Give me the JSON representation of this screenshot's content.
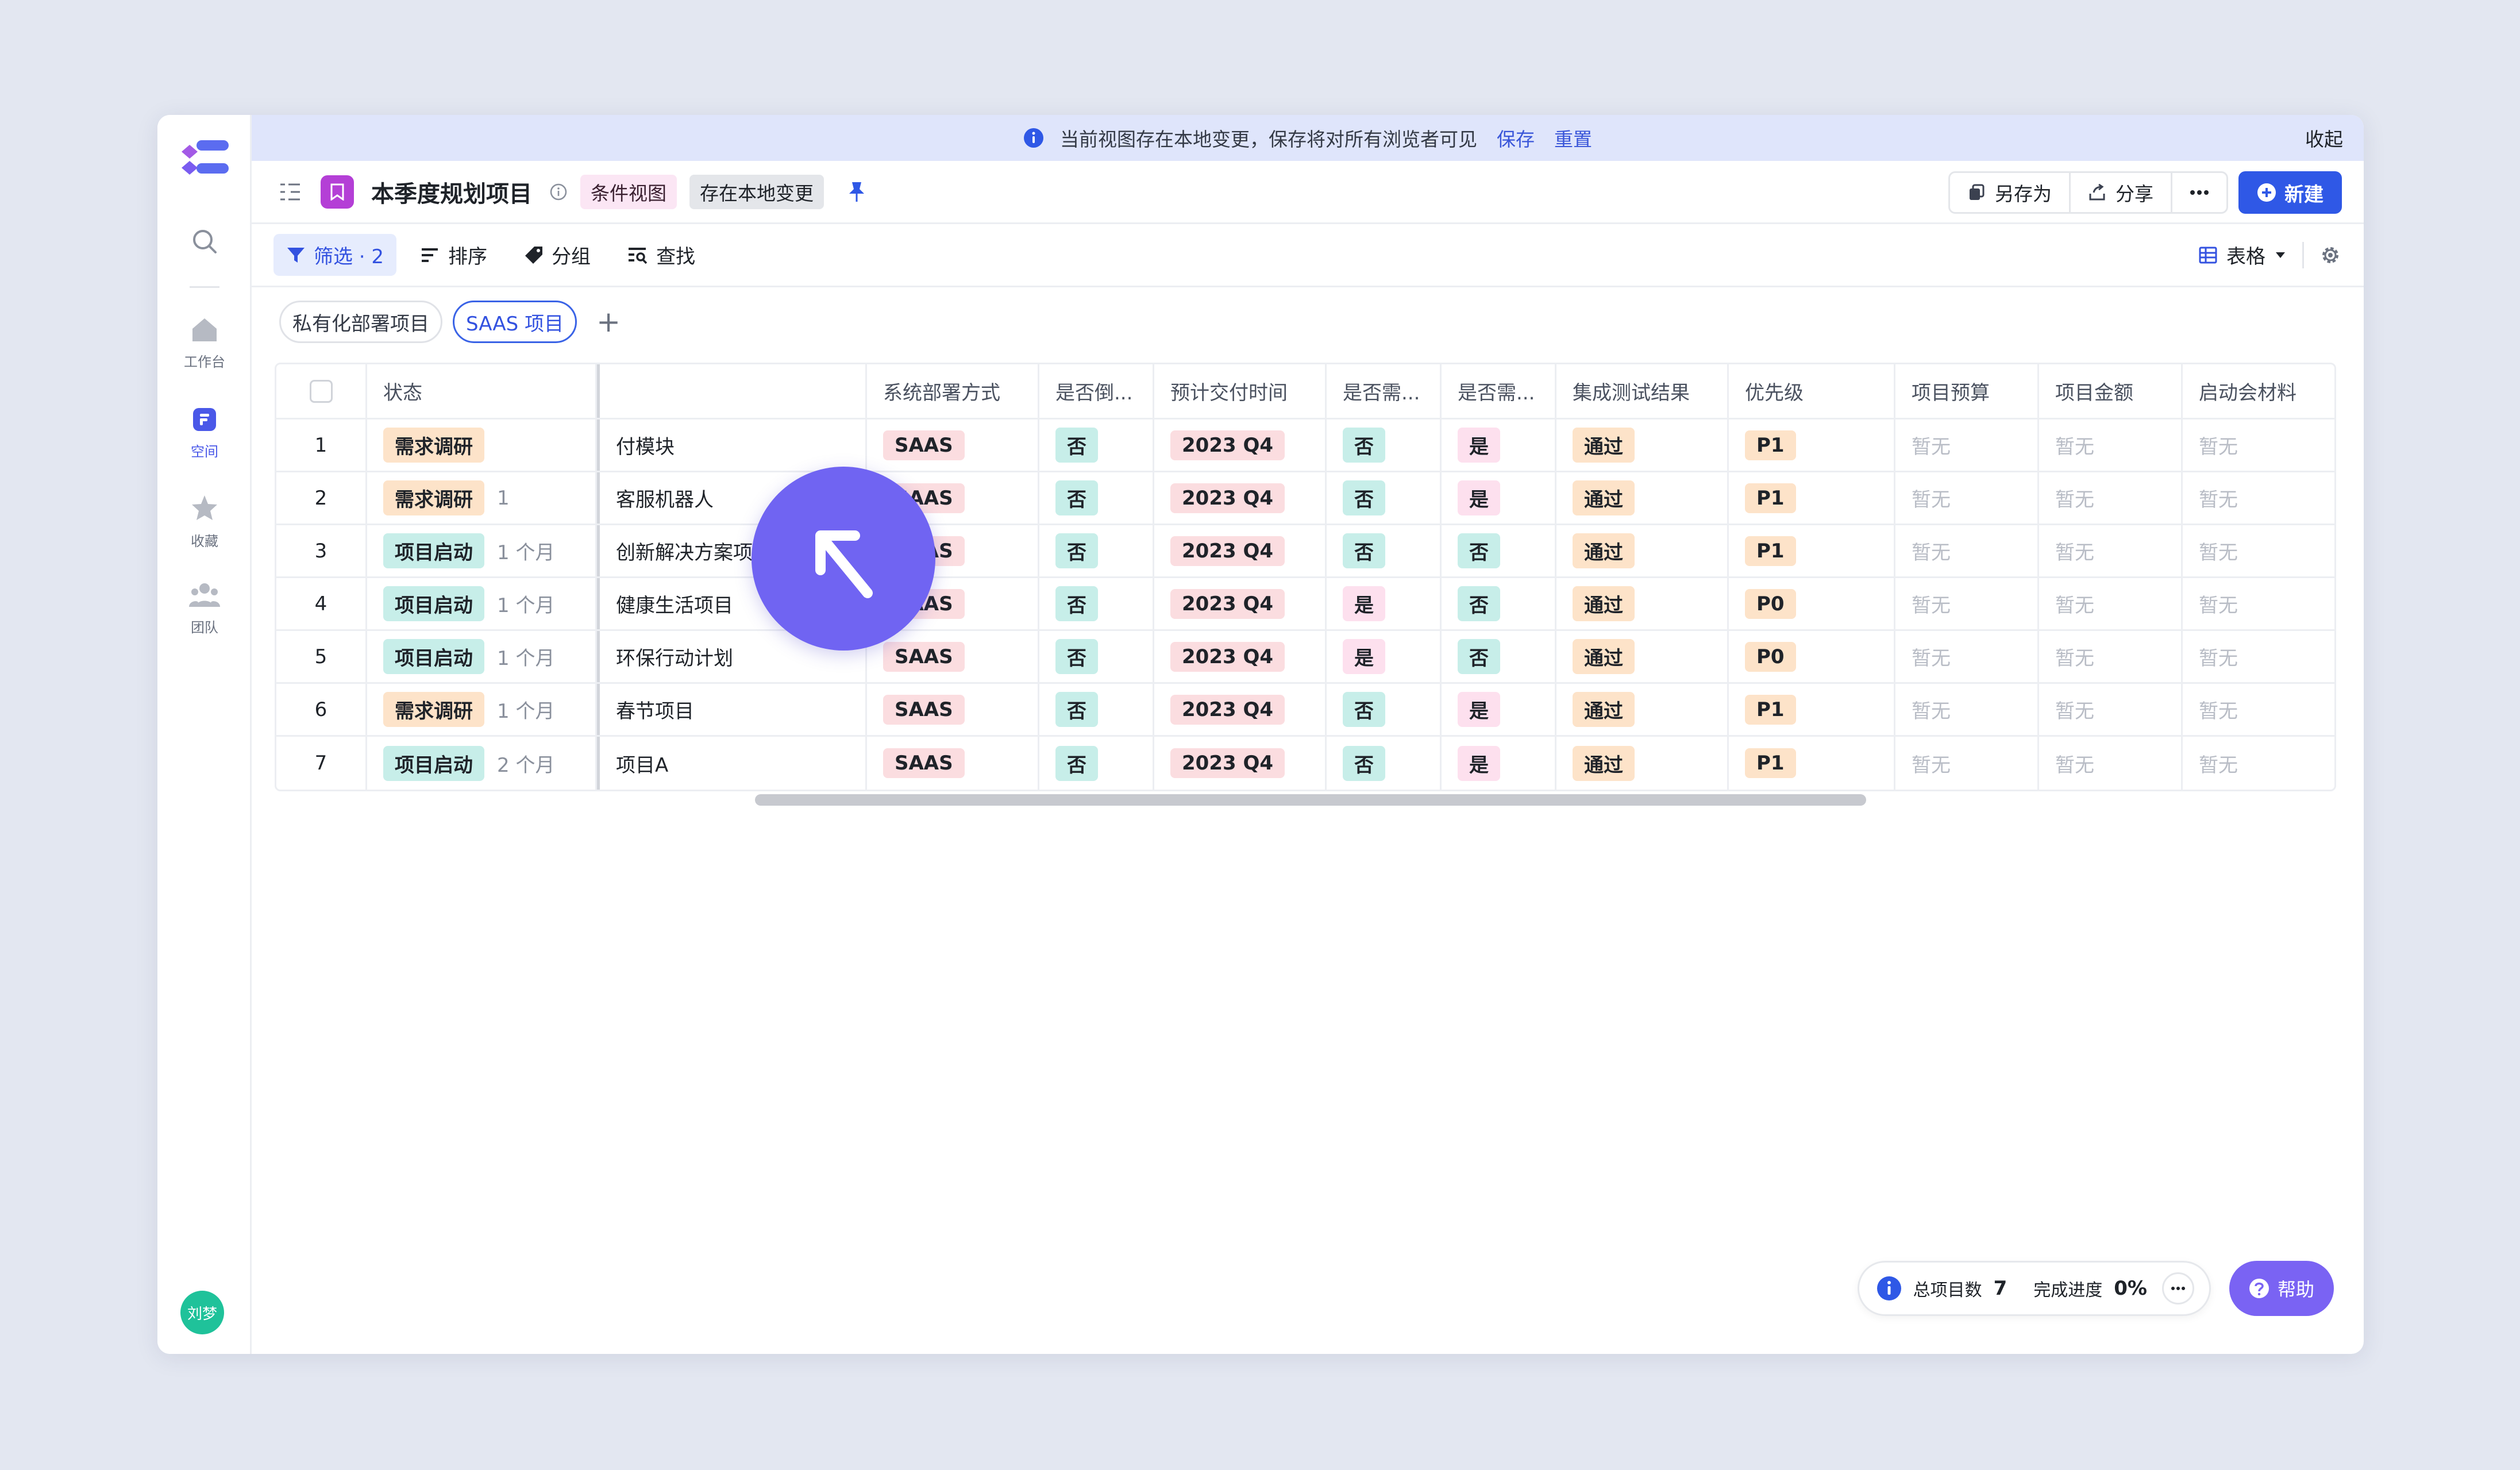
{
  "banner": {
    "message": "当前视图存在本地变更，保存将对所有浏览者可见",
    "save_link": "保存",
    "reset_link": "重置",
    "collapse": "收起"
  },
  "rail": {
    "items": [
      {
        "label": "工作台"
      },
      {
        "label": "空间"
      },
      {
        "label": "收藏"
      },
      {
        "label": "团队"
      }
    ],
    "avatar": "刘梦"
  },
  "header": {
    "title": "本季度规划项目",
    "tag_view": "条件视图",
    "tag_changes": "存在本地变更",
    "save_as": "另存为",
    "share": "分享",
    "new": "新建"
  },
  "toolbar": {
    "filter": "筛选 · 2",
    "sort": "排序",
    "group": "分组",
    "find": "查找",
    "view_mode": "表格"
  },
  "view_tabs": [
    {
      "label": "私有化部署项目"
    },
    {
      "label": "SAAS 项目"
    }
  ],
  "table": {
    "columns": [
      "状态",
      "",
      "系统部署方式",
      "是否倒...",
      "预计交付时间",
      "是否需...",
      "是否需...",
      "集成测试结果",
      "优先级",
      "项目预算",
      "项目金额",
      "启动会材料"
    ],
    "empty_value": "暂无",
    "rows": [
      {
        "no": "1",
        "status": "需求调研",
        "duration": "",
        "name": "付模块",
        "deploy": "SAAS",
        "q1": "否",
        "delivery": "2023 Q4",
        "q2": "否",
        "q3": "是",
        "test": "通过",
        "priority": "P1"
      },
      {
        "no": "2",
        "status": "需求调研",
        "duration": "1",
        "name": "客服机器人",
        "deploy": "SAAS",
        "q1": "否",
        "delivery": "2023 Q4",
        "q2": "否",
        "q3": "是",
        "test": "通过",
        "priority": "P1"
      },
      {
        "no": "3",
        "status": "项目启动",
        "duration": "1 个月",
        "name": "创新解决方案项目",
        "deploy": "SAAS",
        "q1": "否",
        "delivery": "2023 Q4",
        "q2": "否",
        "q3": "否",
        "test": "通过",
        "priority": "P1"
      },
      {
        "no": "4",
        "status": "项目启动",
        "duration": "1 个月",
        "name": "健康生活项目",
        "deploy": "SAAS",
        "q1": "否",
        "delivery": "2023 Q4",
        "q2": "是",
        "q3": "否",
        "test": "通过",
        "priority": "P0"
      },
      {
        "no": "5",
        "status": "项目启动",
        "duration": "1 个月",
        "name": "环保行动计划",
        "deploy": "SAAS",
        "q1": "否",
        "delivery": "2023 Q4",
        "q2": "是",
        "q3": "否",
        "test": "通过",
        "priority": "P0"
      },
      {
        "no": "6",
        "status": "需求调研",
        "duration": "1 个月",
        "name": "春节项目",
        "deploy": "SAAS",
        "q1": "否",
        "delivery": "2023 Q4",
        "q2": "否",
        "q3": "是",
        "test": "通过",
        "priority": "P1"
      },
      {
        "no": "7",
        "status": "项目启动",
        "duration": "2 个月",
        "name": "项目A",
        "deploy": "SAAS",
        "q1": "否",
        "delivery": "2023 Q4",
        "q2": "否",
        "q3": "是",
        "test": "通过",
        "priority": "P1"
      }
    ]
  },
  "stats": {
    "total_label": "总项目数",
    "total_value": "7",
    "progress_label": "完成进度",
    "progress_value": "0%"
  },
  "help": "帮助",
  "colors": {
    "accent": "#2f58e6",
    "banner_bg": "#dfe5fb",
    "project_icon": "#b43fd6",
    "cursor": "#7064f2",
    "help": "#7a63f3"
  }
}
